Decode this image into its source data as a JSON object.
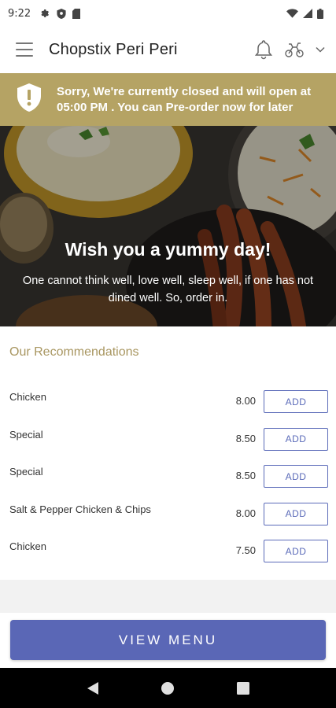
{
  "status_bar": {
    "time": "9:22",
    "left_icons": [
      "gear-icon",
      "shield-icon",
      "sim-icon"
    ],
    "right_icons": [
      "wifi-icon",
      "signal-icon",
      "battery-icon"
    ]
  },
  "app_bar": {
    "title": "Chopstix Peri Peri",
    "icons": [
      "menu-icon",
      "bell-icon",
      "delivery-scooter-icon",
      "chevron-down-icon"
    ]
  },
  "closed_banner": {
    "line1": "Sorry, We're currently closed and will open at",
    "line2": "05:00 PM . You can Pre-order now for later",
    "background": "#b5a364",
    "icon": "shield-alert-icon"
  },
  "hero": {
    "title": "Wish you a yummy day!",
    "subtitle": "One cannot think well, love well, sleep well, if one has not dined well. So, order in."
  },
  "recommendations": {
    "heading": "Our Recommendations",
    "items": [
      {
        "name": "Chicken",
        "price": "8.00",
        "action": "ADD"
      },
      {
        "name": "Special",
        "price": "8.50",
        "action": "ADD"
      },
      {
        "name": "Special",
        "price": "8.50",
        "action": "ADD"
      },
      {
        "name": "Salt & Pepper Chicken & Chips",
        "price": "8.00",
        "action": "ADD"
      },
      {
        "name": "Chicken",
        "price": "7.50",
        "action": "ADD"
      }
    ]
  },
  "view_menu_label": "VIEW MENU",
  "colors": {
    "accent": "#5a67b6",
    "banner_gold": "#b5a364",
    "heading_gold": "#a89660"
  },
  "nav_bar": {
    "buttons": [
      "back-icon",
      "home-icon",
      "recents-icon"
    ]
  }
}
